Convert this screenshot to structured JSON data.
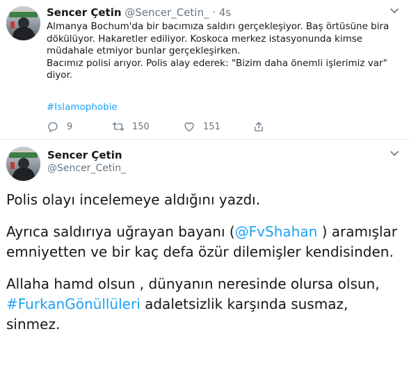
{
  "tweet1": {
    "author_name": "Sencer Çetin",
    "author_handle": "@Sencer_Cetin_",
    "separator": "·",
    "time": "4s",
    "lines": [
      "Almanya Bochum'da bir bacımıza saldırı gerçekleşiyor. Baş örtüsüne bira",
      "dökülüyor. Hakaretler ediliyor. Koskoca merkez istasyonunda kimse",
      "müdahale etmiyor bunlar gerçekleşirken.",
      "Bacımız polisi arıyor. Polis alay ederek: \"Bizim daha önemli işlerimiz var\"",
      "diyor."
    ],
    "hashtag": "#Islamophobie",
    "actions": {
      "reply_count": "9",
      "retweet_count": "150",
      "like_count": "151"
    },
    "icons": [
      "reply-icon",
      "retweet-icon",
      "like-icon",
      "share-icon",
      "chevron-down-icon"
    ]
  },
  "tweet2": {
    "author_name": "Sencer Çetin",
    "author_handle": "@Sencer_Cetin_",
    "para1": "Polis olayı incelemeye aldığını yazdı.",
    "para2": {
      "line1_before": "Ayrıca saldırıya uğrayan bayanı (",
      "mention": "@FvShahan",
      "line1_after": " ) aramışlar",
      "line2": "emniyetten ve bir kaç defa özür dilemişler kendisinden."
    },
    "para3": {
      "line1": "Allaha hamd olsun , dünyanın neresinde olursa olsun,",
      "hashtag": "#FurkanGönüllüleri",
      "line2_after": " adaletsizlik karşında susmaz,",
      "line3": "sinmez."
    }
  },
  "colors": {
    "link": "#1da1f2",
    "text": "#14171a",
    "secondary": "#657786",
    "divider": "#e6ecf0"
  }
}
